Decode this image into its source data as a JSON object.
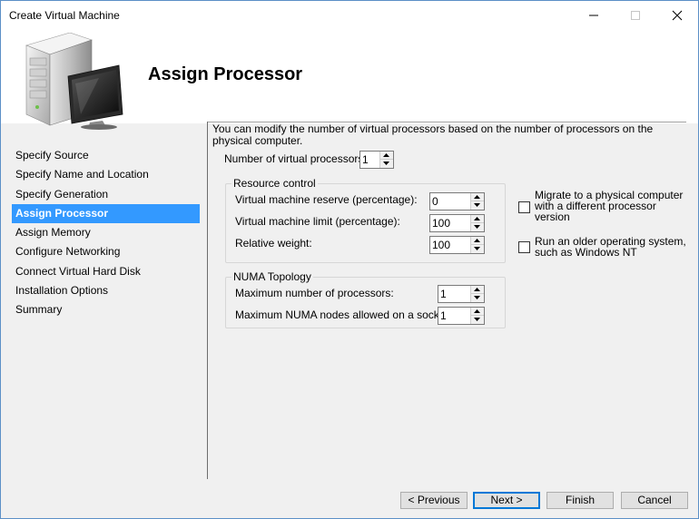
{
  "window": {
    "title": "Create Virtual Machine"
  },
  "header": {
    "title": "Assign Processor"
  },
  "nav": {
    "items": [
      {
        "label": "Specify Source"
      },
      {
        "label": "Specify Name and Location"
      },
      {
        "label": "Specify Generation"
      },
      {
        "label": "Assign Processor"
      },
      {
        "label": "Assign Memory"
      },
      {
        "label": "Configure Networking"
      },
      {
        "label": "Connect Virtual Hard Disk"
      },
      {
        "label": "Installation Options"
      },
      {
        "label": "Summary"
      }
    ],
    "active_index": 3
  },
  "content": {
    "description": "You can modify the number of virtual processors based on the number of processors on the physical computer.",
    "virtual_processors": {
      "label": "Number of virtual processors",
      "value": "1"
    },
    "resource_control": {
      "title": "Resource control",
      "reserve": {
        "label": "Virtual machine reserve (percentage):",
        "value": "0"
      },
      "limit": {
        "label": "Virtual machine limit (percentage):",
        "value": "100"
      },
      "weight": {
        "label": "Relative weight:",
        "value": "100"
      }
    },
    "numa": {
      "title": "NUMA Topology",
      "max_processors": {
        "label": "Maximum number of processors:",
        "value": "1"
      },
      "max_nodes": {
        "label": "Maximum NUMA nodes allowed on a socket",
        "value": "1"
      }
    },
    "options": {
      "migrate": {
        "label": "Migrate to a physical computer with a different processor version",
        "checked": false
      },
      "older_os": {
        "label": "Run an older operating system, such as Windows NT",
        "checked": false
      }
    }
  },
  "buttons": {
    "previous": "< Previous",
    "next": "Next >",
    "finish": "Finish",
    "cancel": "Cancel"
  },
  "colors": {
    "nav_active": "#3399ff",
    "window_border": "#5b8fc7",
    "default_button": "#0078d7"
  },
  "icons": {
    "minimize": "minimize-icon",
    "maximize": "maximize-icon",
    "close": "close-icon",
    "header_graphic": "server-computer-icon",
    "spin_up": "spin-up-arrow-icon",
    "spin_down": "spin-down-arrow-icon"
  }
}
